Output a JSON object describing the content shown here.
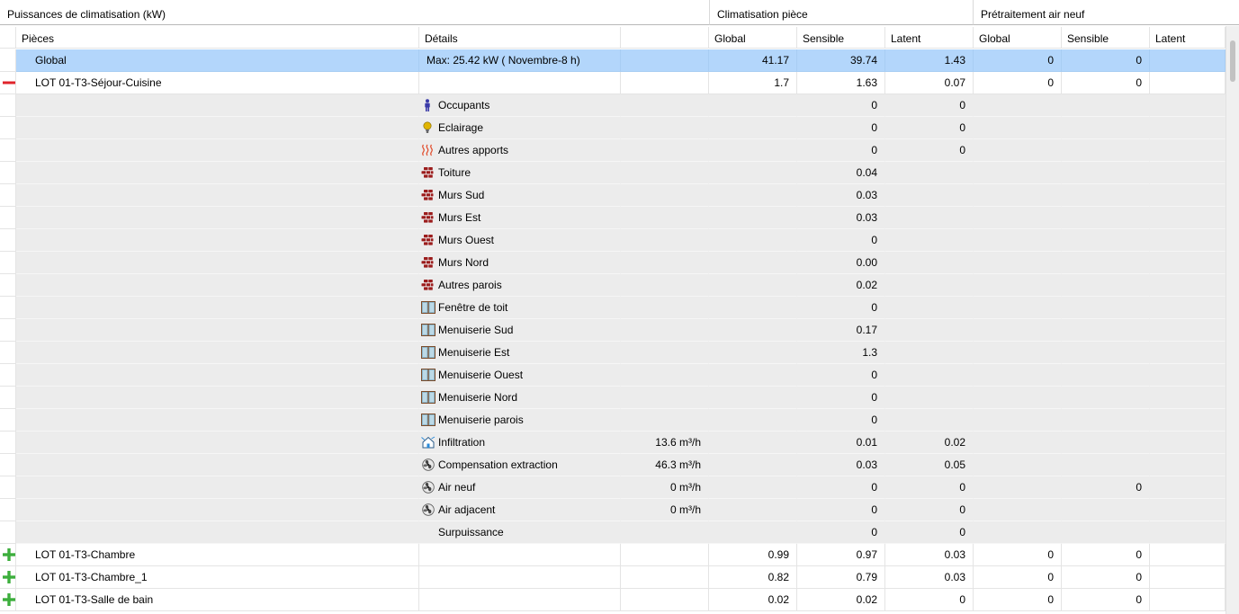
{
  "header": {
    "group_main": "Puissances de climatisation (kW)",
    "group_room": "Climatisation pièce",
    "group_air": "Prétraitement air neuf"
  },
  "columns": [
    "Pièces",
    "Détails",
    "",
    "Global",
    "Sensible",
    "Latent",
    "Global",
    "Sensible",
    "Latent"
  ],
  "rows": [
    {
      "kind": "global",
      "gutter": "",
      "piece": "Global",
      "detail": "Max: 25.42 kW ( Novembre-8 h)",
      "flow": "",
      "r_global": "41.17",
      "r_sens": "39.74",
      "r_lat": "1.43",
      "a_global": "0",
      "a_sens": "0",
      "a_lat": ""
    },
    {
      "kind": "room",
      "gutter": "collapse-icon",
      "piece": "LOT 01-T3-Séjour-Cuisine",
      "detail": "",
      "flow": "",
      "r_global": "1.7",
      "r_sens": "1.63",
      "r_lat": "0.07",
      "a_global": "0",
      "a_sens": "0",
      "a_lat": ""
    },
    {
      "kind": "detail",
      "icon": "person-icon",
      "detail": "Occupants",
      "flow": "",
      "r_sens": "0",
      "r_lat": "0",
      "a_sens": ""
    },
    {
      "kind": "detail",
      "icon": "lightbulb-icon",
      "detail": "Eclairage",
      "flow": "",
      "r_sens": "0",
      "r_lat": "0",
      "a_sens": ""
    },
    {
      "kind": "detail",
      "icon": "heat-waves-icon",
      "detail": "Autres apports",
      "flow": "",
      "r_sens": "0",
      "r_lat": "0",
      "a_sens": ""
    },
    {
      "kind": "detail",
      "icon": "bricks-icon",
      "detail": "Toiture",
      "flow": "",
      "r_sens": "0.04",
      "r_lat": "",
      "a_sens": ""
    },
    {
      "kind": "detail",
      "icon": "bricks-icon",
      "detail": "Murs Sud",
      "flow": "",
      "r_sens": "0.03",
      "r_lat": "",
      "a_sens": ""
    },
    {
      "kind": "detail",
      "icon": "bricks-icon",
      "detail": "Murs Est",
      "flow": "",
      "r_sens": "0.03",
      "r_lat": "",
      "a_sens": ""
    },
    {
      "kind": "detail",
      "icon": "bricks-icon",
      "detail": "Murs Ouest",
      "flow": "",
      "r_sens": "0",
      "r_lat": "",
      "a_sens": ""
    },
    {
      "kind": "detail",
      "icon": "bricks-icon",
      "detail": "Murs Nord",
      "flow": "",
      "r_sens": "0.00",
      "r_lat": "",
      "a_sens": ""
    },
    {
      "kind": "detail",
      "icon": "bricks-icon",
      "detail": "Autres parois",
      "flow": "",
      "r_sens": "0.02",
      "r_lat": "",
      "a_sens": ""
    },
    {
      "kind": "detail",
      "icon": "window-icon",
      "detail": "Fenêtre de toit",
      "flow": "",
      "r_sens": "0",
      "r_lat": "",
      "a_sens": ""
    },
    {
      "kind": "detail",
      "icon": "window-icon",
      "detail": "Menuiserie Sud",
      "flow": "",
      "r_sens": "0.17",
      "r_lat": "",
      "a_sens": ""
    },
    {
      "kind": "detail",
      "icon": "window-icon",
      "detail": "Menuiserie Est",
      "flow": "",
      "r_sens": "1.3",
      "r_lat": "",
      "a_sens": ""
    },
    {
      "kind": "detail",
      "icon": "window-icon",
      "detail": "Menuiserie Ouest",
      "flow": "",
      "r_sens": "0",
      "r_lat": "",
      "a_sens": ""
    },
    {
      "kind": "detail",
      "icon": "window-icon",
      "detail": "Menuiserie Nord",
      "flow": "",
      "r_sens": "0",
      "r_lat": "",
      "a_sens": ""
    },
    {
      "kind": "detail",
      "icon": "window-icon",
      "detail": "Menuiserie parois",
      "flow": "",
      "r_sens": "0",
      "r_lat": "",
      "a_sens": ""
    },
    {
      "kind": "detail",
      "icon": "infiltration-icon",
      "detail": "Infiltration",
      "flow": "13.6 m³/h",
      "r_sens": "0.01",
      "r_lat": "0.02",
      "a_sens": ""
    },
    {
      "kind": "detail",
      "icon": "fan-icon",
      "detail": "Compensation extraction",
      "flow": "46.3 m³/h",
      "r_sens": "0.03",
      "r_lat": "0.05",
      "a_sens": ""
    },
    {
      "kind": "detail",
      "icon": "fan-icon",
      "detail": "Air neuf",
      "flow": "0 m³/h",
      "r_sens": "0",
      "r_lat": "0",
      "a_sens": "0"
    },
    {
      "kind": "detail",
      "icon": "fan-icon",
      "detail": "Air adjacent",
      "flow": "0 m³/h",
      "r_sens": "0",
      "r_lat": "0",
      "a_sens": ""
    },
    {
      "kind": "detail",
      "icon": "",
      "detail": "Surpuissance",
      "flow": "",
      "r_sens": "0",
      "r_lat": "0",
      "a_sens": ""
    },
    {
      "kind": "room",
      "gutter": "expand-icon",
      "piece": "LOT 01-T3-Chambre",
      "detail": "",
      "flow": "",
      "r_global": "0.99",
      "r_sens": "0.97",
      "r_lat": "0.03",
      "a_global": "0",
      "a_sens": "0",
      "a_lat": ""
    },
    {
      "kind": "room",
      "gutter": "expand-icon",
      "piece": "LOT 01-T3-Chambre_1",
      "detail": "",
      "flow": "",
      "r_global": "0.82",
      "r_sens": "0.79",
      "r_lat": "0.03",
      "a_global": "0",
      "a_sens": "0",
      "a_lat": ""
    },
    {
      "kind": "room",
      "gutter": "expand-icon",
      "piece": "LOT 01-T3-Salle de bain",
      "detail": "",
      "flow": "",
      "r_global": "0.02",
      "r_sens": "0.02",
      "r_lat": "0",
      "a_global": "0",
      "a_sens": "0",
      "a_lat": ""
    }
  ],
  "colors": {
    "selection": "#b3d6fb",
    "detail_bg": "#ececec",
    "collapse": "#e0242b",
    "expand": "#3cae3c",
    "brick": "#9b1c1c",
    "person": "#3a3aa8",
    "bulb": "#e0b400"
  }
}
